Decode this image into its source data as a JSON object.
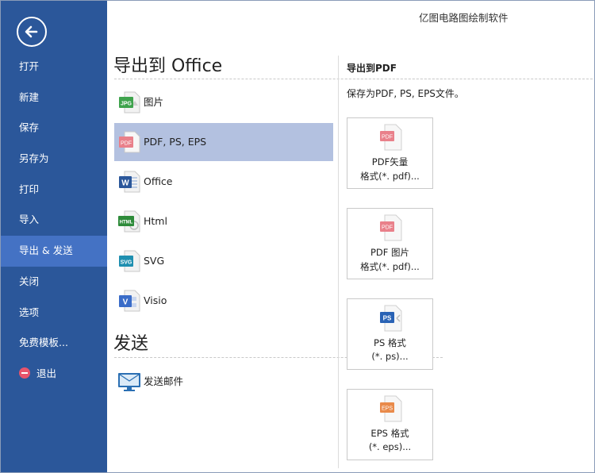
{
  "app_title": "亿图电路图绘制软件",
  "sidebar": {
    "items": [
      {
        "label": "打开"
      },
      {
        "label": "新建"
      },
      {
        "label": "保存"
      },
      {
        "label": "另存为"
      },
      {
        "label": "打印"
      },
      {
        "label": "导入"
      },
      {
        "label": "导出 & 发送",
        "active": true
      },
      {
        "label": "关闭"
      },
      {
        "label": "选项"
      },
      {
        "label": "免费模板..."
      },
      {
        "label": "退出",
        "icon": "exit-icon"
      }
    ]
  },
  "export": {
    "title": "导出到 Office",
    "items": [
      {
        "label": "图片",
        "icon": "jpg-file-icon",
        "badge": "JPG",
        "color": "#3fa34d"
      },
      {
        "label": "PDF, PS, EPS",
        "icon": "pdf-file-icon",
        "badge": "PDF",
        "color": "#e9808a"
      },
      {
        "label": "Office",
        "icon": "word-file-icon",
        "badge": "W",
        "color": "#2b579a"
      },
      {
        "label": "Html",
        "icon": "html-file-icon",
        "badge": "HTML",
        "color": "#2e8b3a"
      },
      {
        "label": "SVG",
        "icon": "svg-file-icon",
        "badge": "SVG",
        "color": "#1f8fb0"
      },
      {
        "label": "Visio",
        "icon": "visio-file-icon",
        "badge": "V",
        "color": "#3a6cc8"
      }
    ]
  },
  "send": {
    "title": "发送",
    "items": [
      {
        "label": "发送邮件",
        "icon": "send-email-icon"
      }
    ]
  },
  "right_panel": {
    "title": "导出到PDF",
    "description": "保存为PDF, PS, EPS文件。",
    "cards": [
      {
        "line1": "PDF矢量",
        "line2": "格式(*. pdf)...",
        "icon": "pdf-vector-icon",
        "badge": "PDF",
        "color": "#e9808a"
      },
      {
        "line1": "PDF 图片",
        "line2": "格式(*. pdf)...",
        "icon": "pdf-image-icon",
        "badge": "PDF",
        "color": "#e9808a"
      },
      {
        "line1": "PS 格式",
        "line2": "(*. ps)...",
        "icon": "ps-file-icon",
        "badge": "PS",
        "color": "#2a63b5"
      },
      {
        "line1": "EPS 格式",
        "line2": "(*. eps)...",
        "icon": "eps-file-icon",
        "badge": "EPS",
        "color": "#e98a4a"
      }
    ]
  },
  "colors": {
    "sidebar_bg": "#2b579a",
    "sidebar_active": "#4472c4",
    "selected_item": "#b3c1e0"
  }
}
